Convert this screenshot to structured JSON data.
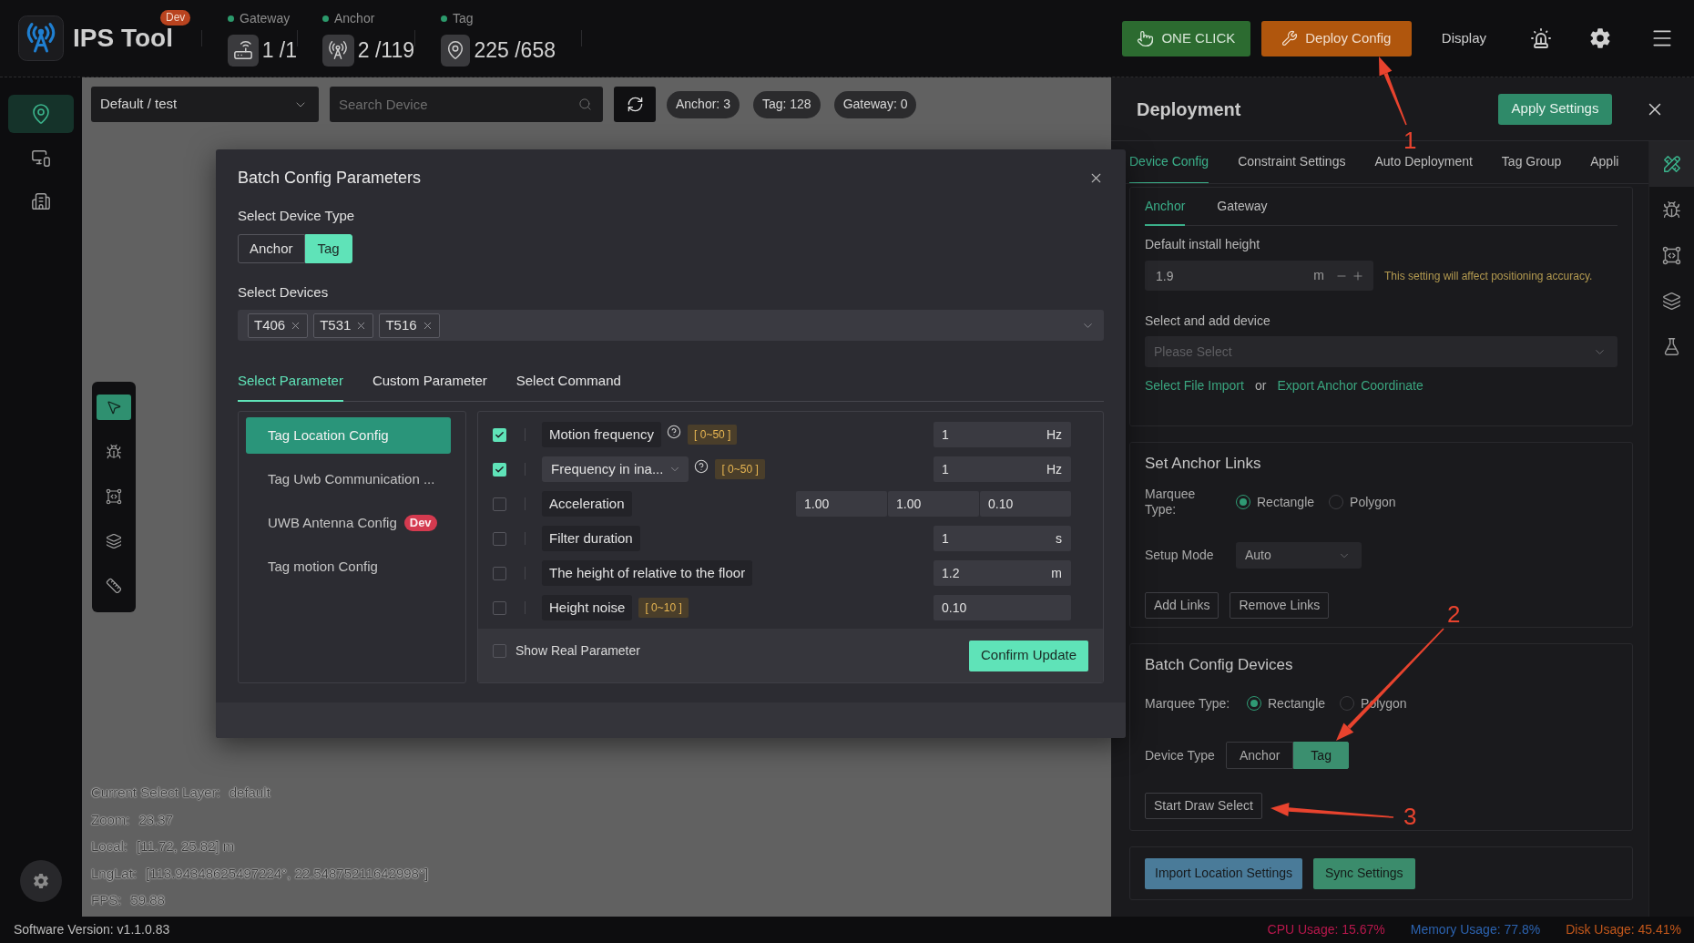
{
  "header": {
    "app_name": "IPS Tool",
    "badge": "Dev",
    "stats": [
      {
        "label": "Gateway",
        "value": "1 /1"
      },
      {
        "label": "Anchor",
        "value": "2 /119"
      },
      {
        "label": "Tag",
        "value": "225 /658"
      }
    ],
    "actions": [
      {
        "kind": "primary",
        "label": "ONE CLICK"
      },
      {
        "kind": "warning",
        "label": "Deploy Config"
      },
      {
        "kind": "text",
        "label": "Display"
      }
    ]
  },
  "sidebar": {
    "items": [
      {
        "selected": true
      },
      {
        "selected": false
      },
      {
        "selected": false
      }
    ]
  },
  "map": {
    "layer": "Default / test",
    "search": {
      "placeholder": "Search Device"
    },
    "chips": [
      "Anchor: 3",
      "Tag: 128",
      "Gateway: 0"
    ],
    "tools": [
      {
        "selected": true
      },
      {
        "selected": false
      },
      {
        "selected": false
      },
      {
        "selected": false
      },
      {
        "selected": false
      }
    ],
    "info": [
      {
        "label": "Current Select Layer:",
        "value": "default"
      },
      {
        "label": "Zoom:",
        "value": "23.37"
      },
      {
        "label": "Local:",
        "value": "[11.72, 25.82] m"
      },
      {
        "label": "LngLat:",
        "value": "[113.94348625497224°, 22.54875211642998°]"
      },
      {
        "label": "FPS:",
        "value": "59.88"
      }
    ]
  },
  "batch_dialog": {
    "title": "Batch Config Parameters",
    "device_type": {
      "label": "Select Device Type",
      "options": [
        {
          "label": "Anchor",
          "selected": false
        },
        {
          "label": "Tag",
          "selected": true
        }
      ]
    },
    "devices": {
      "label": "Select Devices",
      "tags": [
        "T406",
        "T531",
        "T516"
      ]
    },
    "tabs": [
      {
        "label": "Select Parameter",
        "selected": true
      },
      {
        "label": "Custom Parameter",
        "selected": false
      },
      {
        "label": "Select Command",
        "selected": false
      }
    ],
    "categories": [
      {
        "label": "Tag Location Config",
        "selected": true
      },
      {
        "label": "Tag Uwb Communication ...",
        "selected": false
      },
      {
        "label": "UWB Antenna Config",
        "badge": "Dev",
        "selected": false
      },
      {
        "label": "Tag motion Config",
        "selected": false
      }
    ],
    "params": [
      {
        "kind": "field",
        "checked": true,
        "label": "Motion frequency",
        "help": true,
        "range": "[ 0~50 ]",
        "values": [
          "1"
        ],
        "unit": "Hz"
      },
      {
        "kind": "select",
        "checked": true,
        "label": "Frequency in ina...",
        "help": true,
        "range": "[ 0~50 ]",
        "values": [
          "1"
        ],
        "unit": "Hz"
      },
      {
        "kind": "field",
        "checked": false,
        "label": "Acceleration",
        "help": false,
        "values": [
          "1.00",
          "1.00",
          "0.10"
        ]
      },
      {
        "kind": "field",
        "checked": false,
        "label": "Filter duration",
        "help": false,
        "values": [
          "1"
        ],
        "unit": "s"
      },
      {
        "kind": "field",
        "checked": false,
        "label": "The height of relative to the floor",
        "help": false,
        "values": [
          "1.2"
        ],
        "unit": "m"
      },
      {
        "kind": "field",
        "checked": false,
        "label": "Height noise",
        "help": false,
        "range": "[ 0~10 ]",
        "values": [
          "0.10"
        ]
      }
    ],
    "show_real": {
      "label": "Show Real Parameter",
      "checked": false
    },
    "confirm": "Confirm Update"
  },
  "deployment": {
    "title": "Deployment",
    "apply": "Apply Settings",
    "tabs": [
      {
        "label": "Device Config",
        "selected": true
      },
      {
        "label": "Constraint Settings",
        "selected": false
      },
      {
        "label": "Auto Deployment",
        "selected": false
      },
      {
        "label": "Tag Group",
        "selected": false
      },
      {
        "label": "Appli",
        "selected": false
      }
    ],
    "subtabs": [
      {
        "label": "Anchor",
        "selected": true
      },
      {
        "label": "Gateway",
        "selected": false
      }
    ],
    "install_height": {
      "label": "Default install height",
      "value": "1.9",
      "unit": "m",
      "warning": "This setting will affect positioning accuracy."
    },
    "add_device": {
      "label": "Select and add device",
      "placeholder": "Please Select"
    },
    "links": {
      "import": "Select File Import",
      "separator": "or",
      "export": "Export Anchor Coordinate"
    },
    "anchor_links": {
      "title": "Set Anchor Links",
      "marquee": {
        "label": "Marquee Type:",
        "options": [
          {
            "label": "Rectangle",
            "selected": true
          },
          {
            "label": "Polygon",
            "selected": false
          }
        ]
      },
      "setup_mode": {
        "label": "Setup Mode",
        "value": "Auto"
      },
      "buttons": [
        "Add Links",
        "Remove Links"
      ]
    },
    "batch_devices": {
      "title": "Batch Config Devices",
      "marquee": {
        "label": "Marquee Type:",
        "options": [
          {
            "label": "Rectangle",
            "selected": true
          },
          {
            "label": "Polygon",
            "selected": false
          }
        ]
      },
      "device_type": {
        "label": "Device Type",
        "options": [
          {
            "label": "Anchor",
            "selected": false
          },
          {
            "label": "Tag",
            "selected": true
          }
        ]
      },
      "button": "Start Draw Select"
    },
    "actions": [
      {
        "kind": "info",
        "label": "Import Location Settings"
      },
      {
        "kind": "success",
        "label": "Sync Settings"
      }
    ],
    "rail": [
      {
        "selected": true
      },
      {
        "selected": false
      },
      {
        "selected": false
      },
      {
        "selected": false
      },
      {
        "selected": false
      }
    ]
  },
  "status_bar": {
    "version": "Software Version: v1.1.0.83",
    "metrics": [
      {
        "text": "CPU Usage: 15.67%",
        "color": "#b8174c"
      },
      {
        "text": "Memory Usage: 77.8%",
        "color": "#2c63b0"
      },
      {
        "text": "Disk Usage: 45.41%",
        "color": "#c2571b"
      }
    ]
  },
  "annotations": [
    {
      "label": "1"
    },
    {
      "label": "2"
    },
    {
      "label": "3"
    }
  ]
}
